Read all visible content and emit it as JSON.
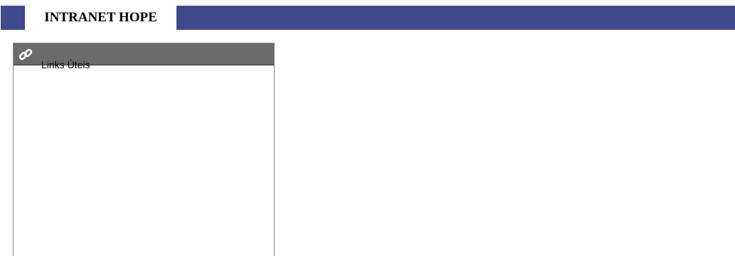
{
  "header": {
    "title": "INTRANET HOPE",
    "accent_color": "#404a8a"
  },
  "links_panel": {
    "icon": "link-icon",
    "title": "Links Úteis",
    "header_color": "#6b6b6b"
  }
}
